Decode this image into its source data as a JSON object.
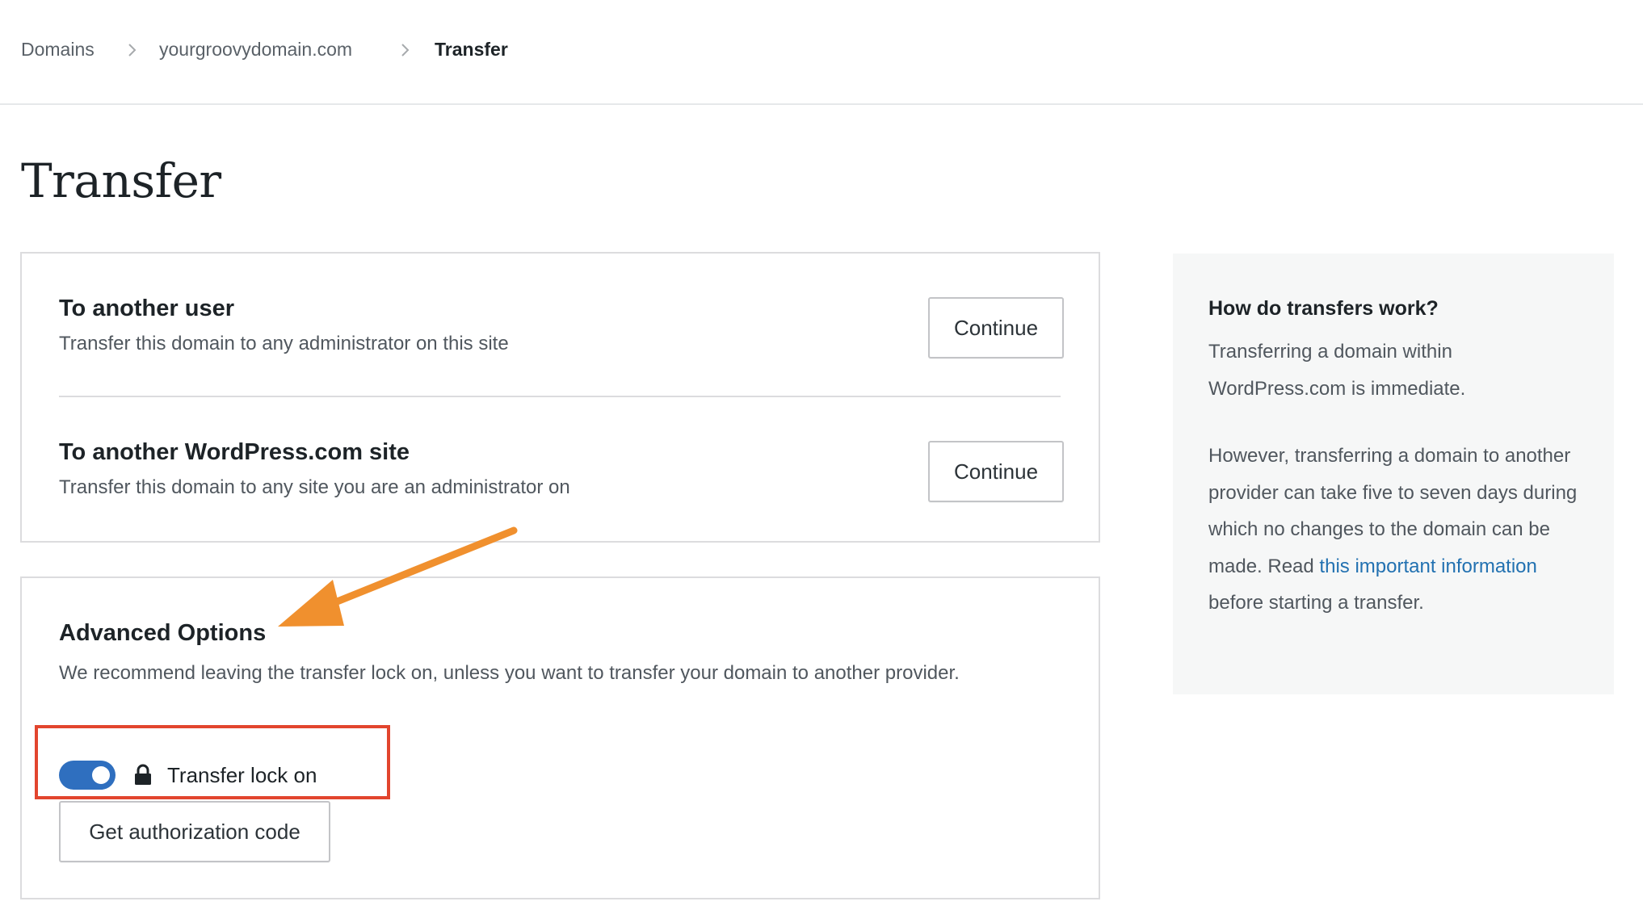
{
  "breadcrumb": {
    "items": [
      "Domains",
      "yourgroovydomain.com",
      "Transfer"
    ]
  },
  "page": {
    "title": "Transfer"
  },
  "transfer_options": [
    {
      "title": "To another user",
      "description": "Transfer this domain to any administrator on this site",
      "button_label": "Continue"
    },
    {
      "title": "To another WordPress.com site",
      "description": "Transfer this domain to any site you are an administrator on",
      "button_label": "Continue"
    }
  ],
  "advanced": {
    "title": "Advanced Options",
    "description": "We recommend leaving the transfer lock on, unless you want to transfer your domain to another provider.",
    "lock_label": "Transfer lock on",
    "lock_enabled": true,
    "auth_button_label": "Get authorization code"
  },
  "side_panel": {
    "title": "How do transfers work?",
    "paragraph1": "Transferring a domain within WordPress.com is immediate.",
    "paragraph2_before": "However, transferring a domain to another provider can take five to seven days during which no changes to the domain can be made. Read ",
    "paragraph2_link": "this important information",
    "paragraph2_after": " before starting a transfer."
  },
  "colors": {
    "accent_blue": "#2f6fbf",
    "link_blue": "#2271b1",
    "annotation_red": "#e2452e",
    "annotation_orange": "#f0902e"
  },
  "icons": [
    "chevron-right-icon",
    "lock-icon"
  ]
}
